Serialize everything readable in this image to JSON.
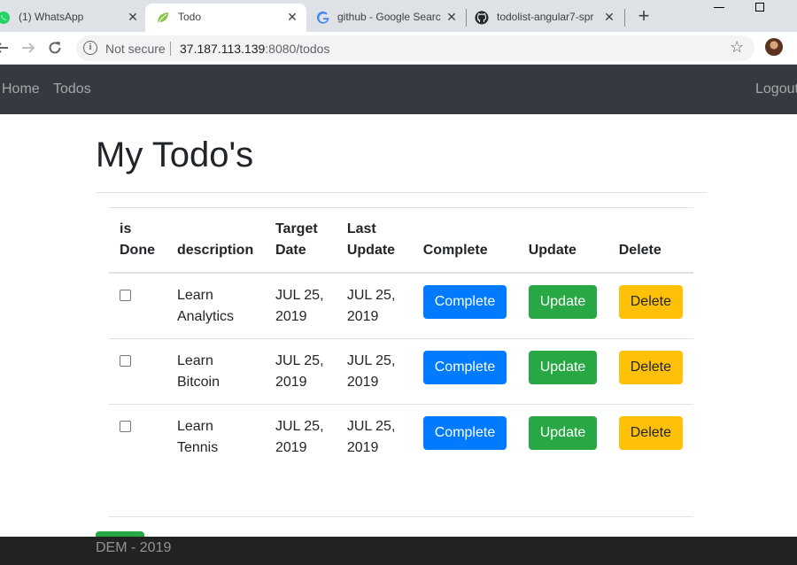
{
  "browser": {
    "tabs": [
      {
        "title": "(1) WhatsApp",
        "icon": "whatsapp-icon",
        "active": false
      },
      {
        "title": "Todo",
        "icon": "spring-leaf-icon",
        "active": true
      },
      {
        "title": "github - Google Searc",
        "icon": "google-icon",
        "active": false
      },
      {
        "title": "todolist-angular7-spr",
        "icon": "github-icon",
        "active": false
      }
    ],
    "security_label": "Not secure",
    "url_host": "37.187.113.139",
    "url_rest": ":8080/todos"
  },
  "navbar": {
    "home": "Home",
    "todos": "Todos",
    "logout": "Logout"
  },
  "main": {
    "title": "My Todo's",
    "columns": {
      "is_done_1": "is",
      "is_done_2": "Done",
      "description": "description",
      "target_date_1": "Target",
      "target_date_2": "Date",
      "last_update_1": "Last",
      "last_update_2": "Update",
      "complete": "Complete",
      "update": "Update",
      "delete": "Delete"
    },
    "rows": [
      {
        "desc_1": "Learn",
        "desc_2": "Analytics",
        "target_1": "JUL 25,",
        "target_2": "2019",
        "updated_1": "JUL 25,",
        "updated_2": "2019",
        "done": false
      },
      {
        "desc_1": "Learn",
        "desc_2": "Bitcoin",
        "target_1": "JUL 25,",
        "target_2": "2019",
        "updated_1": "JUL 25,",
        "updated_2": "2019",
        "done": false
      },
      {
        "desc_1": "Learn Tennis",
        "desc_2": "",
        "target_1": "JUL 25,",
        "target_2": "2019",
        "updated_1": "JUL 25,",
        "updated_2": "2019",
        "done": false
      }
    ],
    "buttons": {
      "complete": "Complete",
      "update": "Update",
      "delete": "Delete"
    }
  },
  "footer": {
    "text": "DEM - 2019"
  },
  "colors": {
    "navbar": "#343a40",
    "primary": "#007bff",
    "success": "#28a745",
    "warning": "#ffc107",
    "footer": "#222222"
  }
}
